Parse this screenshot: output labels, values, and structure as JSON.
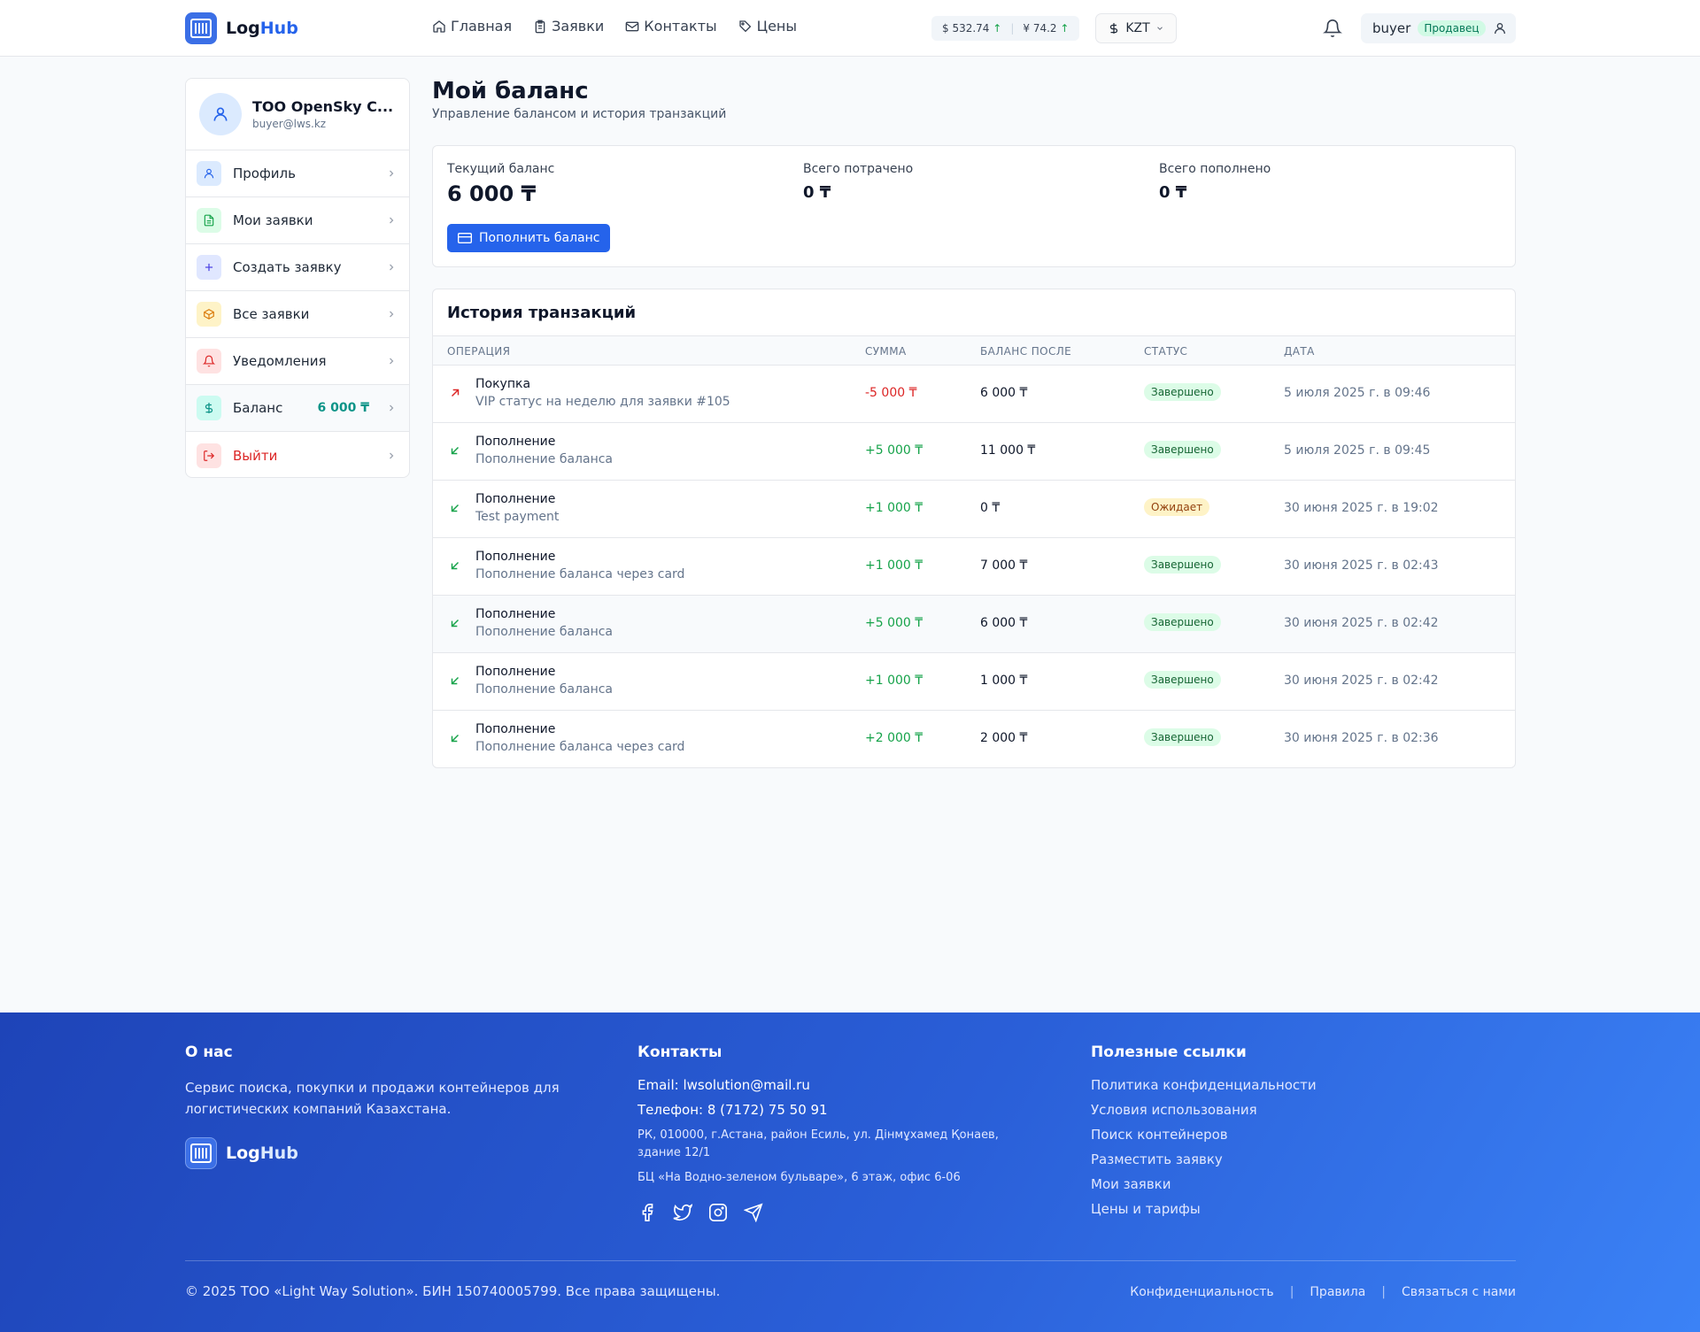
{
  "header": {
    "logo_part1": "Log",
    "logo_part2": "Hub",
    "nav": [
      {
        "label": "Главная",
        "icon": "home-icon"
      },
      {
        "label": "Заявки",
        "icon": "clipboard-icon"
      },
      {
        "label": "Контакты",
        "icon": "mail-icon"
      },
      {
        "label": "Цены",
        "icon": "tag-icon"
      }
    ],
    "rates": {
      "usd": "$ 532.74",
      "usd_trend": "↑",
      "cny": "¥ 74.2",
      "cny_trend": "↑"
    },
    "currency": "KZT",
    "user": {
      "name": "buyer",
      "role": "Продавец"
    }
  },
  "sidebar": {
    "company": "ТОО OpenSky C...",
    "email": "buyer@lws.kz",
    "items": [
      {
        "label": "Профиль",
        "icon": "user-icon",
        "value": ""
      },
      {
        "label": "Мои заявки",
        "icon": "document-icon",
        "value": ""
      },
      {
        "label": "Создать заявку",
        "icon": "plus-icon",
        "value": ""
      },
      {
        "label": "Все заявки",
        "icon": "box-icon",
        "value": ""
      },
      {
        "label": "Уведомления",
        "icon": "bell-icon",
        "value": ""
      },
      {
        "label": "Баланс",
        "icon": "dollar-icon",
        "value": "6 000 ₸"
      },
      {
        "label": "Выйти",
        "icon": "logout-icon",
        "value": ""
      }
    ]
  },
  "main": {
    "title": "Мой баланс",
    "subtitle": "Управление балансом и история транзакций",
    "balance": {
      "current_label": "Текущий баланс",
      "current_value": "6 000 ₸",
      "spent_label": "Всего потрачено",
      "spent_value": "0 ₸",
      "topped_label": "Всего пополнено",
      "topped_value": "0 ₸",
      "topup_button": "Пополнить баланс"
    },
    "history": {
      "title": "История транзакций",
      "columns": [
        "ОПЕРАЦИЯ",
        "СУММА",
        "БАЛАНС ПОСЛЕ",
        "СТАТУС",
        "ДАТА"
      ],
      "rows": [
        {
          "type": "Покупка",
          "desc": "VIP статус на неделю для заявки #105",
          "amount": "-5 000 ₸",
          "balance": "6 000 ₸",
          "status": "Завершено",
          "date": "5 июля 2025 г. в 09:46"
        },
        {
          "type": "Пополнение",
          "desc": "Пополнение баланса",
          "amount": "+5 000 ₸",
          "balance": "11 000 ₸",
          "status": "Завершено",
          "date": "5 июля 2025 г. в 09:45"
        },
        {
          "type": "Пополнение",
          "desc": "Test payment",
          "amount": "+1 000 ₸",
          "balance": "0 ₸",
          "status": "Ожидает",
          "date": "30 июня 2025 г. в 19:02"
        },
        {
          "type": "Пополнение",
          "desc": "Пополнение баланса через card",
          "amount": "+1 000 ₸",
          "balance": "7 000 ₸",
          "status": "Завершено",
          "date": "30 июня 2025 г. в 02:43"
        },
        {
          "type": "Пополнение",
          "desc": "Пополнение баланса",
          "amount": "+5 000 ₸",
          "balance": "6 000 ₸",
          "status": "Завершено",
          "date": "30 июня 2025 г. в 02:42"
        },
        {
          "type": "Пополнение",
          "desc": "Пополнение баланса",
          "amount": "+1 000 ₸",
          "balance": "1 000 ₸",
          "status": "Завершено",
          "date": "30 июня 2025 г. в 02:42"
        },
        {
          "type": "Пополнение",
          "desc": "Пополнение баланса через card",
          "amount": "+2 000 ₸",
          "balance": "2 000 ₸",
          "status": "Завершено",
          "date": "30 июня 2025 г. в 02:36"
        }
      ]
    }
  },
  "footer": {
    "about_title": "О нас",
    "about_text": "Сервис поиска, покупки и продажи контейнеров для логистических компаний Казахстана.",
    "logo_part1": "Log",
    "logo_part2": "Hub",
    "contacts_title": "Контакты",
    "email": "Email: lwsolution@mail.ru",
    "phone": "Телефон: 8 (7172) 75 50 91",
    "address": "РК, 010000, г.Астана, район Есиль, ул. Дінмұхамед Қонаев, здание 12/1",
    "office": "БЦ «На Водно-зеленом бульваре», 6 этаж, офис 6-06",
    "links_title": "Полезные ссылки",
    "links": [
      "Политика конфиденциальности",
      "Условия использования",
      "Поиск контейнеров",
      "Разместить заявку",
      "Мои заявки",
      "Цены и тарифы"
    ],
    "copyright": "© 2025 ТОО «Light Way Solution». БИН 150740005799. Все права защищены.",
    "bottom_links": [
      "Конфиденциальность",
      "Правила",
      "Связаться с нами"
    ]
  },
  "colors": {
    "accent": "#2563eb",
    "success": "#16a34a",
    "danger": "#dc2626",
    "teal": "#0d9488"
  }
}
